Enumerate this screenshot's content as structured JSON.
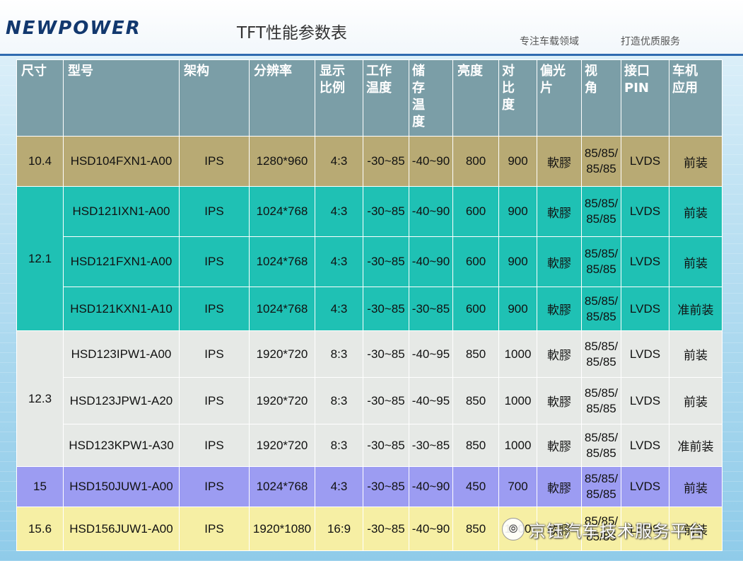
{
  "header": {
    "logo": "NEWPOWER",
    "title": "TFT性能参数表",
    "tagline_1": "专注车载领域",
    "tagline_2": "打造优质服务"
  },
  "table": {
    "columns": [
      "尺寸",
      "型号",
      "架构",
      "分辨率",
      "显示比例",
      "工作温度",
      "储存温度",
      "亮度",
      "对比度",
      "偏光片",
      "视角",
      "接口PIN",
      "车机应用"
    ],
    "header_lines": {
      "ratio": [
        "显示",
        "比例"
      ],
      "op_temp": [
        "工作",
        "温度"
      ],
      "storage_temp": [
        "储",
        "存",
        "温",
        "度"
      ],
      "contrast": [
        "对",
        "比",
        "度"
      ],
      "polarizer": [
        "偏光",
        "片"
      ],
      "view_angle": [
        "视",
        "角"
      ],
      "interface": [
        "接口",
        "PIN"
      ],
      "application": [
        "车机",
        "应用"
      ]
    },
    "groups": [
      {
        "size": "10.4",
        "rows": [
          {
            "model": "HSD104FXN1-A00",
            "arch": "IPS",
            "res": "1280*960",
            "ratio": "4:3",
            "op": "-30~85",
            "st": "-40~90",
            "bright": "800",
            "contrast": "900",
            "pol": "軟膠",
            "view_1": "85/85/",
            "view_2": "85/85",
            "iface": "LVDS",
            "app": "前装"
          }
        ]
      },
      {
        "size": "12.1",
        "rows": [
          {
            "model": "HSD121IXN1-A00",
            "arch": "IPS",
            "res": "1024*768",
            "ratio": "4:3",
            "op": "-30~85",
            "st": "-40~90",
            "bright": "600",
            "contrast": "900",
            "pol": "軟膠",
            "view_1": "85/85/",
            "view_2": "85/85",
            "iface": "LVDS",
            "app": "前装"
          },
          {
            "model": "HSD121FXN1-A00",
            "arch": "IPS",
            "res": "1024*768",
            "ratio": "4:3",
            "op": "-30~85",
            "st": "-40~90",
            "bright": "600",
            "contrast": "900",
            "pol": "軟膠",
            "view_1": "85/85/",
            "view_2": "85/85",
            "iface": "LVDS",
            "app": "前装"
          },
          {
            "model": "HSD121KXN1-A10",
            "arch": "IPS",
            "res": "1024*768",
            "ratio": "4:3",
            "op": "-30~85",
            "st": "-30~85",
            "bright": "600",
            "contrast": "900",
            "pol": "軟膠",
            "view_1": "85/85/",
            "view_2": "85/85",
            "iface": "LVDS",
            "app": "准前装"
          }
        ]
      },
      {
        "size": "12.3",
        "rows": [
          {
            "model": "HSD123IPW1-A00",
            "arch": "IPS",
            "res": "1920*720",
            "ratio": "8:3",
            "op": "-30~85",
            "st": "-40~95",
            "bright": "850",
            "contrast": "1000",
            "pol": "軟膠",
            "view_1": "85/85/",
            "view_2": "85/85",
            "iface": "LVDS",
            "app": "前装"
          },
          {
            "model": "HSD123JPW1-A20",
            "arch": "IPS",
            "res": "1920*720",
            "ratio": "8:3",
            "op": "-30~85",
            "st": "-40~95",
            "bright": "850",
            "contrast": "1000",
            "pol": "軟膠",
            "view_1": "85/85/",
            "view_2": "85/85",
            "iface": "LVDS",
            "app": "前装"
          },
          {
            "model": "HSD123KPW1-A30",
            "arch": "IPS",
            "res": "1920*720",
            "ratio": "8:3",
            "op": "-30~85",
            "st": "-30~85",
            "bright": "850",
            "contrast": "1000",
            "pol": "軟膠",
            "view_1": "85/85/",
            "view_2": "85/85",
            "iface": "LVDS",
            "app": "准前装"
          }
        ]
      },
      {
        "size": "15",
        "rows": [
          {
            "model": "HSD150JUW1-A00",
            "arch": "IPS",
            "res": "1024*768",
            "ratio": "4:3",
            "op": "-30~85",
            "st": "-40~90",
            "bright": "450",
            "contrast": "700",
            "pol": "軟膠",
            "view_1": "85/85/",
            "view_2": "85/85",
            "iface": "LVDS",
            "app": "前装"
          }
        ]
      },
      {
        "size": "15.6",
        "rows": [
          {
            "model": "HSD156JUW1-A00",
            "arch": "IPS",
            "res": "1920*1080",
            "ratio": "16:9",
            "op": "-30~85",
            "st": "-40~90",
            "bright": "850",
            "contrast": "1000",
            "pol": "軟膠",
            "view_1": "85/85/",
            "view_2": "85/85",
            "iface": "LVDS",
            "app": "前装"
          }
        ]
      }
    ]
  },
  "watermark": {
    "text": "京钰汽车技术服务平台"
  },
  "colors": {
    "header_row": "#7b9ea7",
    "group_10_4": "#b8aa74",
    "group_12_1": "#1fc1b4",
    "group_12_3": "#e6e9e6",
    "group_15": "#9c9cf2",
    "group_15_6": "#f6efa4"
  }
}
